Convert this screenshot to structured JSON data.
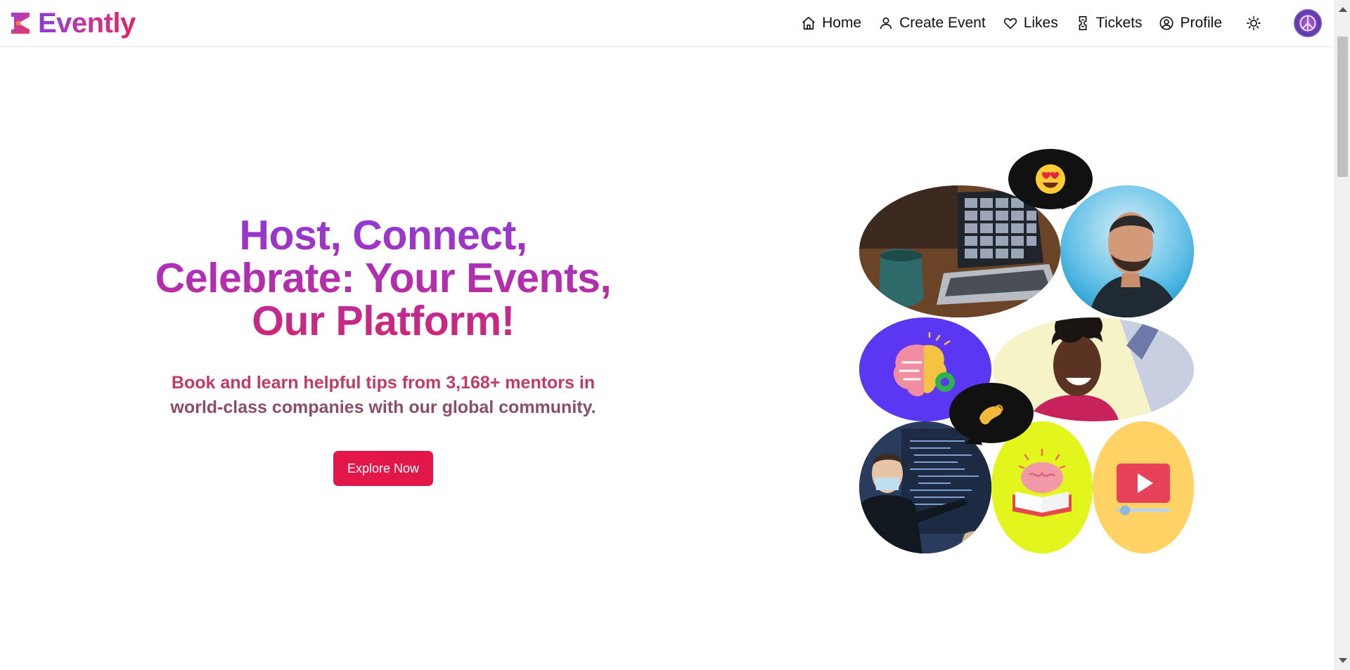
{
  "header": {
    "brand": "Evently",
    "nav": [
      {
        "label": "Home",
        "icon": "home-icon"
      },
      {
        "label": "Create Event",
        "icon": "user-icon"
      },
      {
        "label": "Likes",
        "icon": "heart-icon"
      },
      {
        "label": "Tickets",
        "icon": "ticket-icon"
      },
      {
        "label": "Profile",
        "icon": "profile-icon"
      }
    ],
    "theme_toggle_icon": "sun-icon",
    "avatar_icon": "peace-icon"
  },
  "hero": {
    "title": "Host, Connect, Celebrate: Your Events, Our Platform!",
    "subtitle_part1": "Book and learn helpful tips from 3,168+ mentors in",
    "subtitle_part2": "world-class companies with our global community.",
    "cta": "Explore Now"
  },
  "colors": {
    "brand_purple": "#8b3bd9",
    "brand_pink": "#e0245e",
    "cta_red": "#e3164a"
  }
}
